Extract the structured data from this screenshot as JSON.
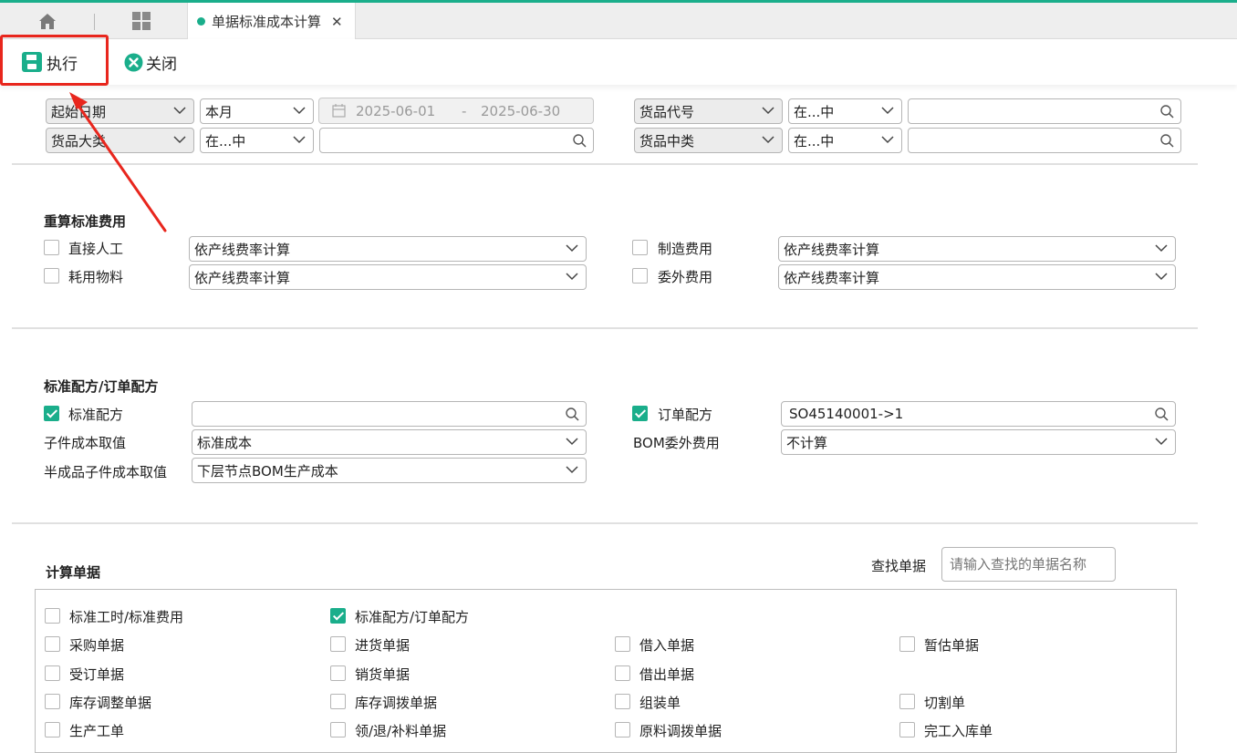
{
  "tabs": {
    "active_label": "单据标准成本计算"
  },
  "toolbar": {
    "execute_label": "执行",
    "close_label": "关闭"
  },
  "filters": {
    "row1_left": {
      "field": "起始日期",
      "period": "本月",
      "date_from": "2025-06-01",
      "date_sep": "-",
      "date_to": "2025-06-30"
    },
    "row1_right": {
      "field": "货品代号",
      "operator": "在...中",
      "value": ""
    },
    "row2_left": {
      "field": "货品大类",
      "operator": "在...中",
      "value": ""
    },
    "row2_right": {
      "field": "货品中类",
      "operator": "在...中",
      "value": ""
    }
  },
  "recalc": {
    "title": "重算标准费用",
    "items": [
      {
        "label": "直接人工",
        "checked": false,
        "method": "依产线费率计算"
      },
      {
        "label": "制造费用",
        "checked": false,
        "method": "依产线费率计算"
      },
      {
        "label": "耗用物料",
        "checked": false,
        "method": "依产线费率计算"
      },
      {
        "label": "委外费用",
        "checked": false,
        "method": "依产线费率计算"
      }
    ]
  },
  "formula": {
    "title": "标准配方/订单配方",
    "std_label": "标准配方",
    "std_checked": true,
    "std_value": "",
    "order_label": "订单配方",
    "order_checked": true,
    "order_value": "SO45140001->1",
    "child_cost_label": "子件成本取值",
    "child_cost_value": "标准成本",
    "bom_out_label": "BOM委外费用",
    "bom_out_value": "不计算",
    "semi_label": "半成品子件成本取值",
    "semi_value": "下层节点BOM生产成本"
  },
  "calc_docs": {
    "title": "计算单据",
    "search_label": "查找单据",
    "search_placeholder": "请输入查找的单据名称",
    "items": [
      {
        "label": "标准工时/标准费用",
        "checked": false
      },
      {
        "label": "标准配方/订单配方",
        "checked": true
      },
      {
        "label": "采购单据",
        "checked": false
      },
      {
        "label": "进货单据",
        "checked": false
      },
      {
        "label": "借入单据",
        "checked": false
      },
      {
        "label": "暂估单据",
        "checked": false
      },
      {
        "label": "受订单据",
        "checked": false
      },
      {
        "label": "销货单据",
        "checked": false
      },
      {
        "label": "借出单据",
        "checked": false
      },
      {
        "label": "库存调整单据",
        "checked": false
      },
      {
        "label": "库存调拨单据",
        "checked": false
      },
      {
        "label": "组装单",
        "checked": false
      },
      {
        "label": "切割单",
        "checked": false
      },
      {
        "label": "生产工单",
        "checked": false
      },
      {
        "label": "领/退/补料单据",
        "checked": false
      },
      {
        "label": "原料调拨单据",
        "checked": false
      },
      {
        "label": "完工入库单",
        "checked": false
      }
    ]
  },
  "colors": {
    "accent": "#1aae8b",
    "highlight": "#e8261d"
  }
}
